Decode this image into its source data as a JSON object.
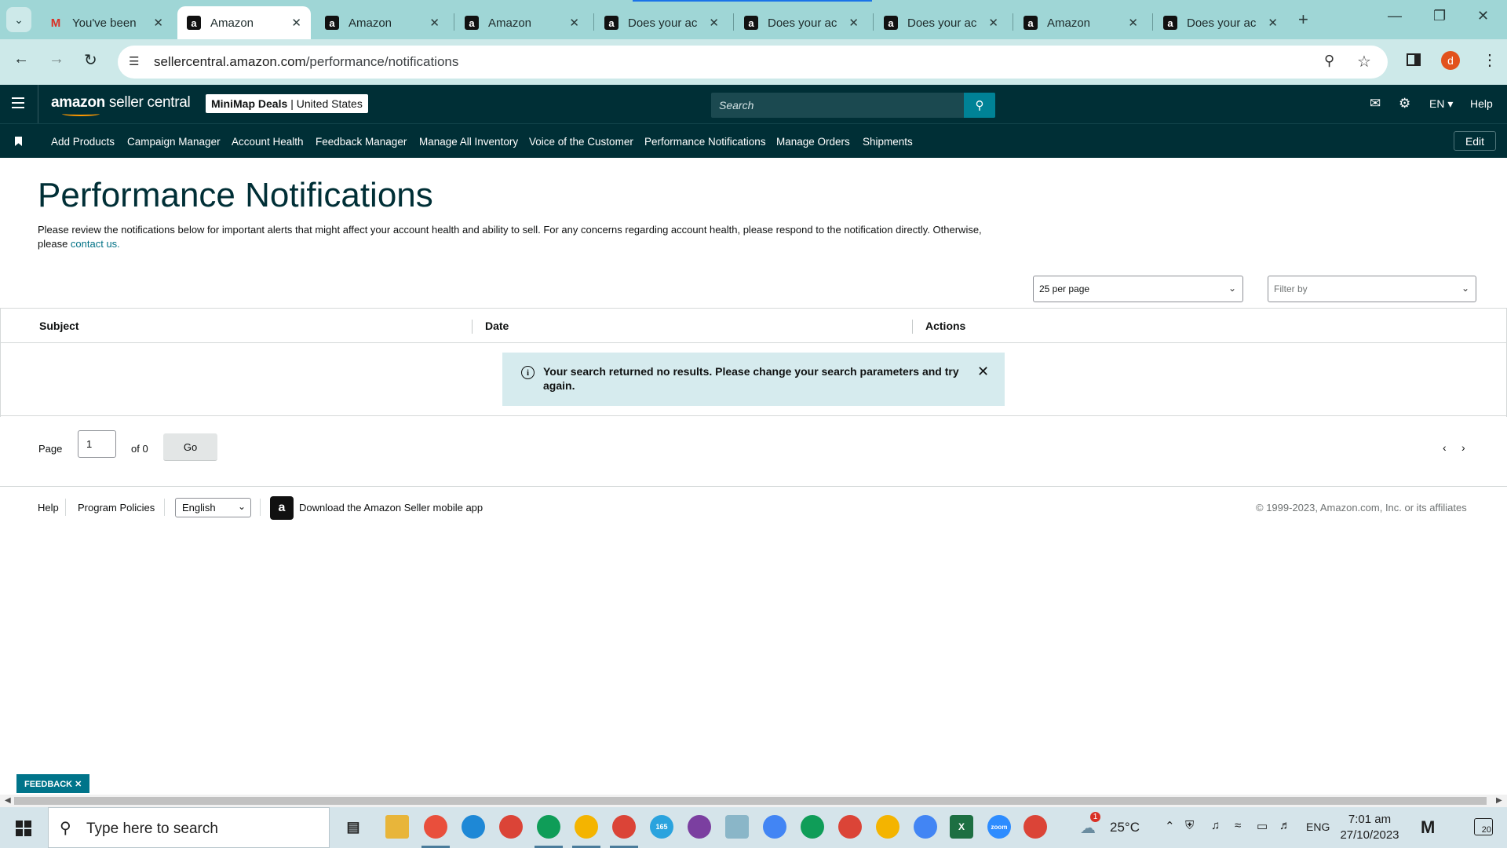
{
  "browser": {
    "tabs": [
      {
        "title": "You've been",
        "favicon": "gmail-icon",
        "active": false
      },
      {
        "title": "Amazon",
        "favicon": "amazon-icon",
        "active": true
      },
      {
        "title": "Amazon",
        "favicon": "amazon-icon",
        "active": false
      },
      {
        "title": "Amazon",
        "favicon": "amazon-icon",
        "active": false
      },
      {
        "title": "Does your ac",
        "favicon": "amazon-icon",
        "active": false
      },
      {
        "title": "Does your ac",
        "favicon": "amazon-icon",
        "active": false
      },
      {
        "title": "Does your ac",
        "favicon": "amazon-icon",
        "active": false
      },
      {
        "title": "Amazon",
        "favicon": "amazon-icon",
        "active": false
      },
      {
        "title": "Does your ac",
        "favicon": "amazon-icon",
        "active": false
      }
    ],
    "url_host": "sellercentral.amazon.com",
    "url_path": "/performance/notifications",
    "profile_initial": "d"
  },
  "header": {
    "logo_bold": "amazon",
    "logo_rest": " seller central",
    "store_name": "MiniMap Deals",
    "marketplace": "| United States",
    "search_placeholder": "Search",
    "language": "EN ▾",
    "help": "Help"
  },
  "nav": {
    "items": [
      "Add Products",
      "Campaign Manager",
      "Account Health",
      "Feedback Manager",
      "Manage All Inventory",
      "Voice of the Customer",
      "Performance Notifications",
      "Manage Orders",
      "Shipments"
    ],
    "edit_label": "Edit"
  },
  "page": {
    "title": "Performance Notifications",
    "description": "Please review the notifications below for important alerts that might affect your account health and ability to sell. For any concerns regarding account health, please respond to the notification directly. Otherwise, please ",
    "contact_link": "contact us.",
    "per_page_value": "25 per page",
    "filter_placeholder": "Filter by"
  },
  "table": {
    "columns": [
      "Subject",
      "Date",
      "Actions"
    ],
    "alert_message": "Your search returned no results. Please change your search parameters and try again."
  },
  "pagination": {
    "page_label": "Page",
    "current_page": "1",
    "of_label": "of 0",
    "go_label": "Go"
  },
  "footer": {
    "help": "Help",
    "program_policies": "Program Policies",
    "language": "English",
    "download_app": "Download the Amazon Seller mobile app",
    "copyright": "© 1999-2023, Amazon.com, Inc. or its affiliates"
  },
  "feedback_tab": "FEEDBACK ✕",
  "taskbar": {
    "search_placeholder": "Type here to search",
    "weather_temp": "25°C",
    "weather_alert_count": "1",
    "language": "ENG",
    "time": "7:01 am",
    "date": "27/10/2023",
    "notification_count": "20",
    "telegram_badge": "165"
  }
}
